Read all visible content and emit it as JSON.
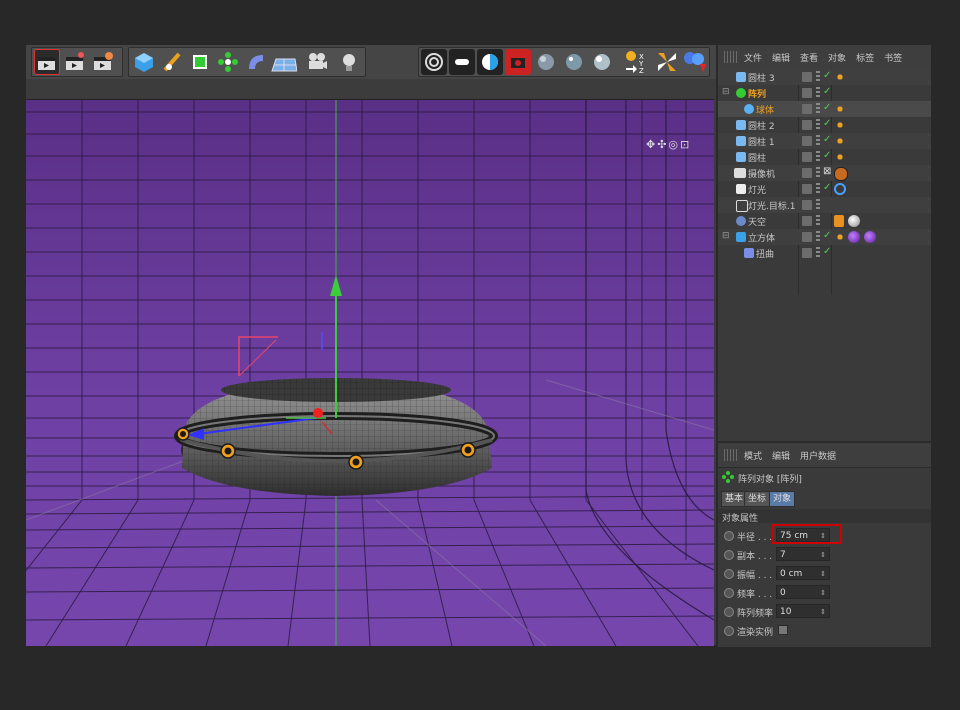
{
  "viewport_nav": "✥✣◎⊡",
  "outliner": {
    "menu": [
      "文件",
      "编辑",
      "查看",
      "对象",
      "标签",
      "书签"
    ],
    "objects": [
      {
        "name": "圆柱 3",
        "color": "#c8c8c8",
        "icon": "cylinder-icon"
      },
      {
        "name": "阵列",
        "color": "#f0a020",
        "icon": "array-icon"
      },
      {
        "name": "球体",
        "color": "#f0a020",
        "icon": "sphere-icon"
      },
      {
        "name": "圆柱 2",
        "color": "#c8c8c8",
        "icon": "cylinder-icon"
      },
      {
        "name": "圆柱 1",
        "color": "#c8c8c8",
        "icon": "cylinder-icon"
      },
      {
        "name": "圆柱",
        "color": "#c8c8c8",
        "icon": "cylinder-icon"
      },
      {
        "name": "摄像机",
        "color": "#c8c8c8",
        "icon": "camera-icon"
      },
      {
        "name": "灯光",
        "color": "#c8c8c8",
        "icon": "light-icon"
      },
      {
        "name": "灯光.目标.1",
        "color": "#c8c8c8",
        "icon": "target-icon"
      },
      {
        "name": "天空",
        "color": "#c8c8c8",
        "icon": "sky-icon"
      },
      {
        "name": "立方体",
        "color": "#c8c8c8",
        "icon": "cube-icon"
      },
      {
        "name": "扭曲",
        "color": "#c8c8c8",
        "icon": "bend-icon"
      }
    ]
  },
  "attributes": {
    "menu": [
      "模式",
      "编辑",
      "用户数据"
    ],
    "object_title": "阵列对象 [阵列]",
    "tabs": [
      "基本",
      "坐标",
      "对象"
    ],
    "section": "对象属性",
    "rows": [
      {
        "label": "半径 . . .",
        "value": "75 cm"
      },
      {
        "label": "副本 . . .",
        "value": "7"
      },
      {
        "label": "振幅 . . .",
        "value": "0 cm"
      },
      {
        "label": "频率 . . .",
        "value": "0"
      },
      {
        "label": "阵列频率",
        "value": "10"
      },
      {
        "label": "渲染实例",
        "value": ""
      }
    ]
  },
  "colors": {
    "viewport_bg": "#6a3d9a",
    "highlight": "#d00000",
    "selected_text": "#f0a020"
  }
}
